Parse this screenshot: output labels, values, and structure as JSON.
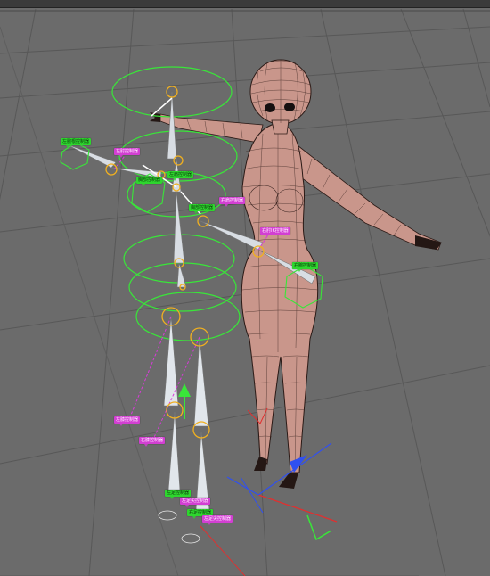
{
  "viewport": {
    "background": "#6b6b6b",
    "grid_color": "#5a5a5a",
    "mesh_color": "#c9968b",
    "mesh_wire_color": "#2b1a16",
    "bone_color": "#d8dde3",
    "ik_circle_color": "#39e639",
    "joint_color": "#f0b020",
    "ik_line_color": "#d93bd9"
  },
  "controller_tags": [
    {
      "label": "左腕根控制器",
      "color": "green"
    },
    {
      "label": "左肘控制器",
      "color": "magenta"
    },
    {
      "label": "左肩控制器",
      "color": "green"
    },
    {
      "label": "胸部控制器",
      "color": "green"
    },
    {
      "label": "右肩控制器",
      "color": "magenta"
    },
    {
      "label": "右肘IK控制器",
      "color": "magenta"
    },
    {
      "label": "右腕控制器",
      "color": "green"
    },
    {
      "label": "左膝控制器",
      "color": "magenta"
    },
    {
      "label": "右膝控制器",
      "color": "magenta"
    },
    {
      "label": "左足控制器",
      "color": "green"
    },
    {
      "label": "左足尖控制器",
      "color": "magenta"
    },
    {
      "label": "右足控制器",
      "color": "green"
    }
  ],
  "axes": {
    "x_color": "#e03030",
    "y_color": "#3ad23a",
    "z_color": "#3050f0"
  }
}
